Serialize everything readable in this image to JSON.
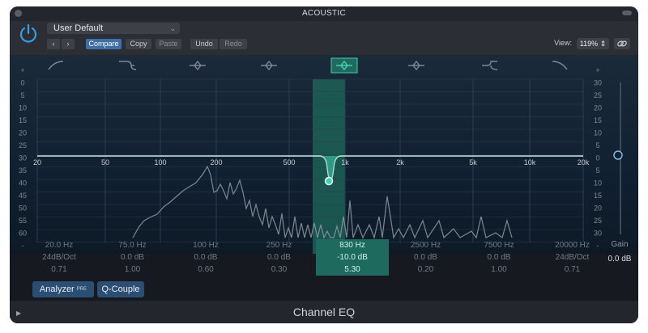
{
  "window": {
    "title": "ACOUSTIC",
    "plugin_name": "Channel EQ"
  },
  "header": {
    "preset": "User Default",
    "compare": "Compare",
    "copy": "Copy",
    "paste": "Paste",
    "undo": "Undo",
    "redo": "Redo",
    "view_label": "View:",
    "view_value": "119%"
  },
  "scale_left": [
    "+",
    "0",
    "5",
    "10",
    "15",
    "20",
    "25",
    "30",
    "35",
    "40",
    "45",
    "50",
    "55",
    "60",
    "-"
  ],
  "scale_right": [
    "+",
    "30",
    "25",
    "20",
    "15",
    "10",
    "5",
    "0",
    "5",
    "10",
    "15",
    "20",
    "25",
    "30",
    "-"
  ],
  "freq_labels": [
    "20",
    "50",
    "100",
    "200",
    "500",
    "1k",
    "2k",
    "5k",
    "10k",
    "20k"
  ],
  "bands": [
    {
      "freq": "20.0 Hz",
      "gain": "24dB/Oct",
      "q": "0.71"
    },
    {
      "freq": "75.0 Hz",
      "gain": "0.0 dB",
      "q": "1.00"
    },
    {
      "freq": "100 Hz",
      "gain": "0.0 dB",
      "q": "0.60"
    },
    {
      "freq": "250 Hz",
      "gain": "0.0 dB",
      "q": "0.30"
    },
    {
      "freq": "830 Hz",
      "gain": "-10.0 dB",
      "q": "5.30"
    },
    {
      "freq": "2500 Hz",
      "gain": "0.0 dB",
      "q": "0.20"
    },
    {
      "freq": "7500 Hz",
      "gain": "0.0 dB",
      "q": "1.00"
    },
    {
      "freq": "20000 Hz",
      "gain": "24dB/Oct",
      "q": "0.71"
    }
  ],
  "selected_band": 5,
  "gain": {
    "label": "Gain",
    "value": "0.0 dB"
  },
  "buttons": {
    "analyzer": "Analyzer",
    "analyzer_badge": "PRE",
    "q_couple": "Q-Couple"
  },
  "colors": {
    "accent": "#3fd1b0",
    "selected_band": "#1e6a5e",
    "button_blue": "#2b4e73"
  },
  "icons": [
    "power-icon",
    "chevron-left-icon",
    "chevron-right-icon",
    "link-icon",
    "highpass-icon",
    "low-shelf-icon",
    "bell-icon",
    "high-shelf-icon",
    "lowpass-icon",
    "disclosure-triangle-icon"
  ]
}
